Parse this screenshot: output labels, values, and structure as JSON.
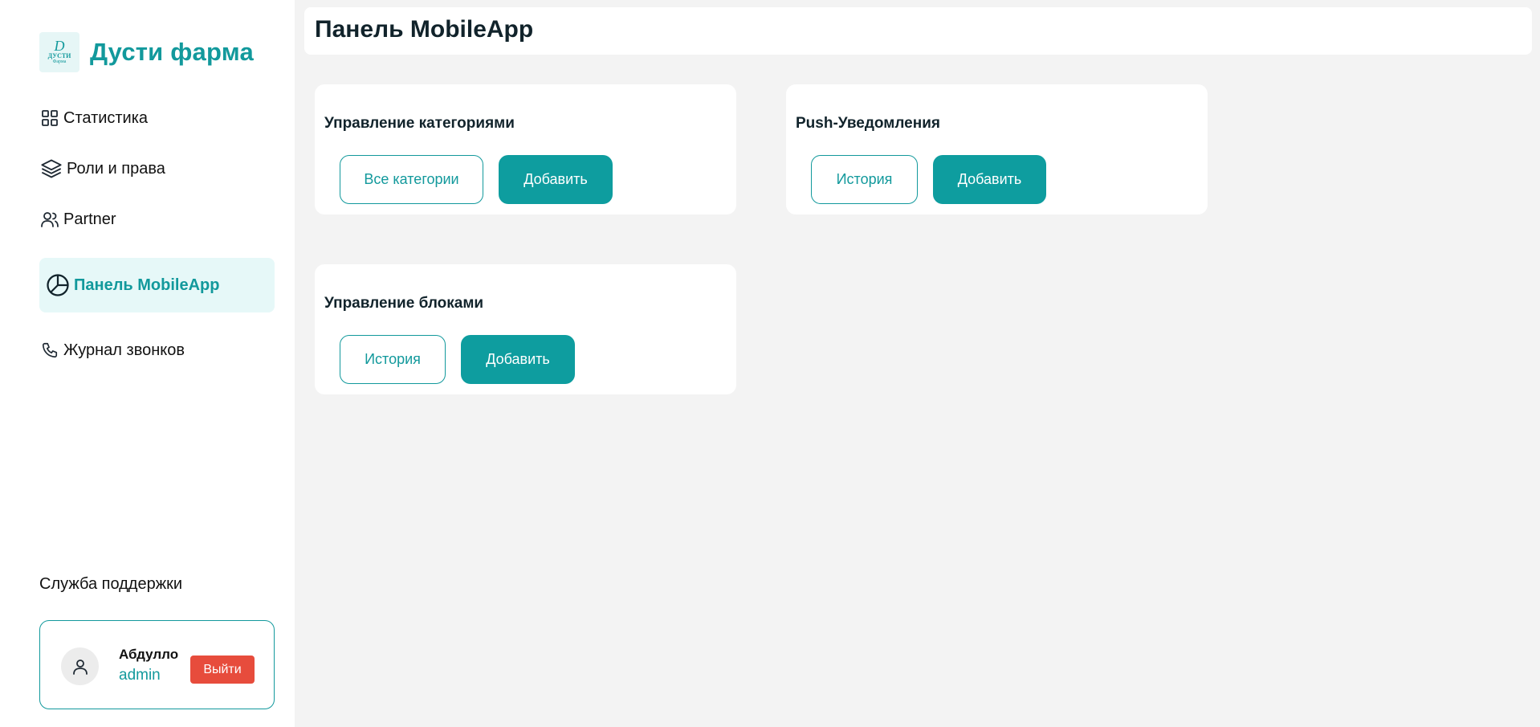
{
  "brand": {
    "name": "Дусти фарма",
    "logo_mark": "D",
    "logo_line1": "ДУСТИ",
    "logo_line2": "Фарма"
  },
  "nav": {
    "items": [
      {
        "label": "Статистика",
        "icon": "grid-icon"
      },
      {
        "label": "Роли и права",
        "icon": "layers-icon"
      },
      {
        "label": "Partner",
        "icon": "users-icon"
      },
      {
        "label": "Панель MobileApp",
        "icon": "pie-chart-icon",
        "active": true
      },
      {
        "label": "Журнал звонков",
        "icon": "phone-icon"
      }
    ]
  },
  "support": {
    "label": "Служба поддержки"
  },
  "user": {
    "name": "Абдулло",
    "role": "admin",
    "logout_label": "Выйти"
  },
  "header": {
    "title": "Панель MobileApp"
  },
  "cards": [
    {
      "title": "Управление категориями",
      "secondary_label": "Все категории",
      "primary_label": "Добавить"
    },
    {
      "title": "Push-Уведомления",
      "secondary_label": "История",
      "primary_label": "Добавить"
    },
    {
      "title": "Управление блоками",
      "secondary_label": "История",
      "primary_label": "Добавить"
    }
  ],
  "colors": {
    "accent": "#12999c",
    "button_primary": "#0e9d9f",
    "logout": "#e74c3c",
    "active_nav_bg": "#e6f8f8",
    "page_bg": "#f3f3f3"
  }
}
